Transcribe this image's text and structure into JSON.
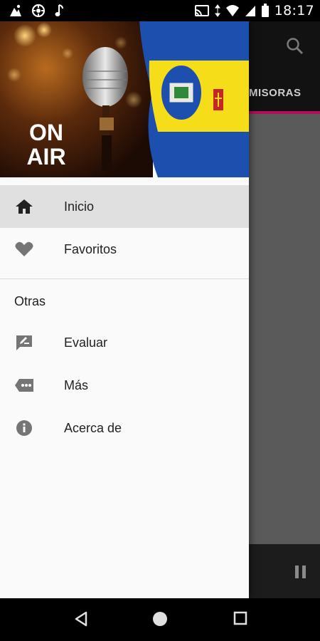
{
  "status_bar": {
    "time": "18:17",
    "left_icons": [
      "app-notification-icon",
      "settings-notification-icon",
      "music-note-icon"
    ],
    "right_icons": [
      "cast-icon",
      "data-arrows-icon",
      "wifi-icon",
      "signal-icon",
      "battery-icon"
    ]
  },
  "drawer": {
    "header": {
      "onair_line1": "ON",
      "onair_line2": "AIR",
      "flag_colors": {
        "blue": "#1d4fae",
        "yellow": "#f6dd1a",
        "red": "#c4262a"
      }
    },
    "items": [
      {
        "label": "Inicio",
        "icon": "home-icon",
        "selected": true
      },
      {
        "label": "Favoritos",
        "icon": "heart-icon",
        "selected": false
      }
    ],
    "section_title": "Otras",
    "other_items": [
      {
        "label": "Evaluar",
        "icon": "rate-review-icon"
      },
      {
        "label": "Más",
        "icon": "more-tag-icon"
      },
      {
        "label": "Acerca de",
        "icon": "info-icon"
      }
    ]
  },
  "background_app": {
    "tab_label": "MISORAS",
    "accent_color": "#b0105a",
    "icons": [
      "search-icon",
      "pause-icon"
    ]
  },
  "nav_bar": {
    "icons": [
      "back-icon",
      "home-circle-icon",
      "recents-icon"
    ]
  }
}
